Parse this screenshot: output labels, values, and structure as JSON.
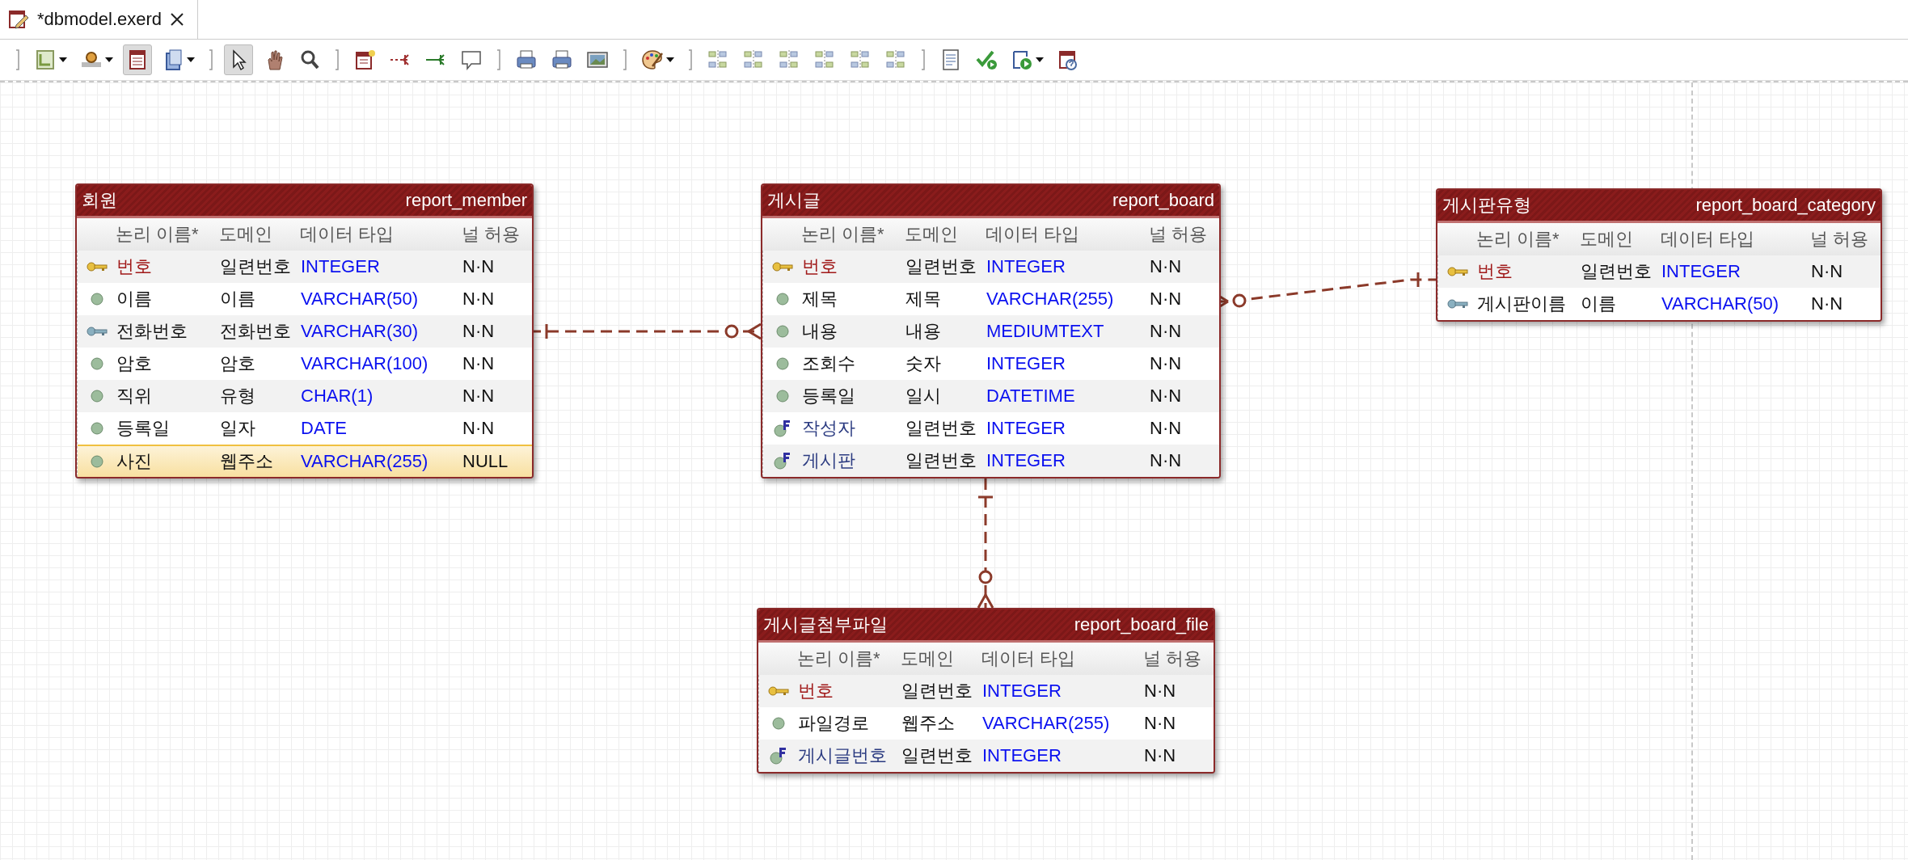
{
  "editor_tab": {
    "title": "*dbmodel.exerd",
    "selected": true
  },
  "tables": [
    {
      "logical_name": "회원",
      "physical_name": "report_member",
      "columns": [
        "논리 이름*",
        "도메인",
        "데이터 타입",
        "널 허용"
      ],
      "rows": [
        {
          "kind": "pk",
          "name": "번호",
          "domain": "일련번호",
          "type": "INTEGER",
          "nullable": "N·N",
          "selected": false
        },
        {
          "kind": "attr",
          "name": "이름",
          "domain": "이름",
          "type": "VARCHAR(50)",
          "nullable": "N·N",
          "selected": false
        },
        {
          "kind": "ak",
          "name": "전화번호",
          "domain": "전화번호",
          "type": "VARCHAR(30)",
          "nullable": "N·N",
          "selected": false
        },
        {
          "kind": "attr",
          "name": "암호",
          "domain": "암호",
          "type": "VARCHAR(100)",
          "nullable": "N·N",
          "selected": false
        },
        {
          "kind": "attr",
          "name": "직위",
          "domain": "유형",
          "type": "CHAR(1)",
          "nullable": "N·N",
          "selected": false
        },
        {
          "kind": "attr",
          "name": "등록일",
          "domain": "일자",
          "type": "DATE",
          "nullable": "N·N",
          "selected": false
        },
        {
          "kind": "attr",
          "name": "사진",
          "domain": "웹주소",
          "type": "VARCHAR(255)",
          "nullable": "NULL",
          "selected": true
        }
      ]
    },
    {
      "logical_name": "게시글",
      "physical_name": "report_board",
      "columns": [
        "논리 이름*",
        "도메인",
        "데이터 타입",
        "널 허용"
      ],
      "rows": [
        {
          "kind": "pk",
          "name": "번호",
          "domain": "일련번호",
          "type": "INTEGER",
          "nullable": "N·N",
          "selected": false
        },
        {
          "kind": "attr",
          "name": "제목",
          "domain": "제목",
          "type": "VARCHAR(255)",
          "nullable": "N·N",
          "selected": false
        },
        {
          "kind": "attr",
          "name": "내용",
          "domain": "내용",
          "type": "MEDIUMTEXT",
          "nullable": "N·N",
          "selected": false
        },
        {
          "kind": "attr",
          "name": "조회수",
          "domain": "숫자",
          "type": "INTEGER",
          "nullable": "N·N",
          "selected": false
        },
        {
          "kind": "attr",
          "name": "등록일",
          "domain": "일시",
          "type": "DATETIME",
          "nullable": "N·N",
          "selected": false
        },
        {
          "kind": "fk",
          "name": "작성자",
          "domain": "일련번호",
          "type": "INTEGER",
          "nullable": "N·N",
          "selected": false
        },
        {
          "kind": "fk",
          "name": "게시판",
          "domain": "일련번호",
          "type": "INTEGER",
          "nullable": "N·N",
          "selected": false
        }
      ]
    },
    {
      "logical_name": "게시판유형",
      "physical_name": "report_board_category",
      "columns": [
        "논리 이름*",
        "도메인",
        "데이터 타입",
        "널 허용"
      ],
      "rows": [
        {
          "kind": "pk",
          "name": "번호",
          "domain": "일련번호",
          "type": "INTEGER",
          "nullable": "N·N",
          "selected": false
        },
        {
          "kind": "ak",
          "name": "게시판이름",
          "domain": "이름",
          "type": "VARCHAR(50)",
          "nullable": "N·N",
          "selected": false
        }
      ]
    },
    {
      "logical_name": "게시글첨부파일",
      "physical_name": "report_board_file",
      "columns": [
        "논리 이름*",
        "도메인",
        "데이터 타입",
        "널 허용"
      ],
      "rows": [
        {
          "kind": "pk",
          "name": "번호",
          "domain": "일련번호",
          "type": "INTEGER",
          "nullable": "N·N",
          "selected": false
        },
        {
          "kind": "attr",
          "name": "파일경로",
          "domain": "웹주소",
          "type": "VARCHAR(255)",
          "nullable": "N·N",
          "selected": false
        },
        {
          "kind": "fk",
          "name": "게시글번호",
          "domain": "일련번호",
          "type": "INTEGER",
          "nullable": "N·N",
          "selected": false
        }
      ]
    }
  ]
}
